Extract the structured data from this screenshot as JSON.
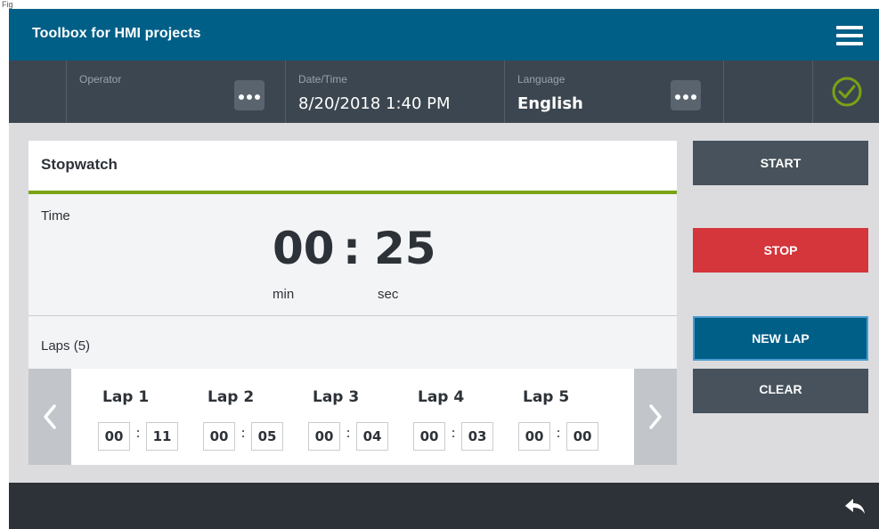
{
  "figure_label": "Fig",
  "app": {
    "title": "Toolbox for HMI projects"
  },
  "header": {
    "operator_caption": "Operator",
    "datetime_caption": "Date/Time",
    "datetime_value": "8/20/2018 1:40 PM",
    "language_caption": "Language",
    "language_value": "English",
    "status_icon": "check-circle-icon",
    "status_color": "#7aa314"
  },
  "stopwatch": {
    "title": "Stopwatch",
    "time_label": "Time",
    "minutes": "00",
    "separator": ":",
    "seconds": "25",
    "min_unit": "min",
    "sec_unit": "sec",
    "laps_label": "Laps (5)",
    "laps": [
      {
        "label": "Lap 1",
        "min": "00",
        "sec": "11"
      },
      {
        "label": "Lap 2",
        "min": "00",
        "sec": "05"
      },
      {
        "label": "Lap 3",
        "min": "00",
        "sec": "04"
      },
      {
        "label": "Lap 4",
        "min": "00",
        "sec": "03"
      },
      {
        "label": "Lap 5",
        "min": "00",
        "sec": "00"
      }
    ],
    "lap_colon": ":"
  },
  "controls": {
    "start_label": "START",
    "stop_label": "STOP",
    "newlap_label": "NEW LAP",
    "clear_label": "CLEAR"
  },
  "colors": {
    "titlebar": "#005f87",
    "accent_green": "#7aa314",
    "stop_red": "#d4363b",
    "button_dark": "#47525c"
  }
}
